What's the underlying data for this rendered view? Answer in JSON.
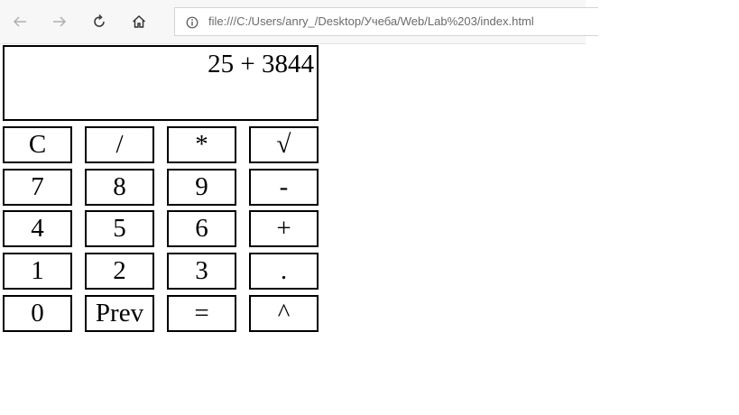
{
  "browser": {
    "url": "file:///C:/Users/anry_/Desktop/Учеба/Web/Lab%203/index.html"
  },
  "calculator": {
    "display": "25 + 3844",
    "keys": {
      "clear": "C",
      "divide": "/",
      "multiply": "*",
      "sqrt": "√",
      "seven": "7",
      "eight": "8",
      "nine": "9",
      "minus": "-",
      "four": "4",
      "five": "5",
      "six": "6",
      "plus": "+",
      "one": "1",
      "two": "2",
      "three": "3",
      "dot": ".",
      "zero": "0",
      "prev": "Prev",
      "equals": "=",
      "power": "^"
    }
  }
}
